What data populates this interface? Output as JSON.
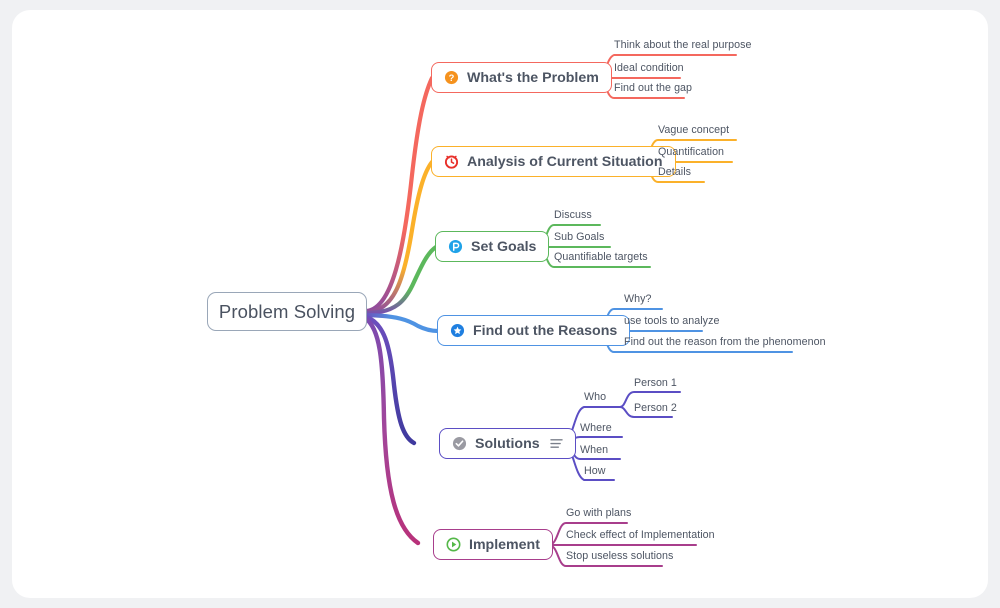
{
  "canvas": {
    "background": "#f0f1f3",
    "sheet_background": "#ffffff"
  },
  "root": {
    "label": "Problem Solving",
    "border_color": "#9aa7b8",
    "text_color": "#4a5260"
  },
  "branches": [
    {
      "id": "whats-the-problem",
      "label": "What's the Problem",
      "color": "#f4685e",
      "icon": "question-circle-icon",
      "icon_color": "#f5921e",
      "children": [
        {
          "label": "Think about the real purpose"
        },
        {
          "label": "Ideal condition"
        },
        {
          "label": "Find out the gap"
        }
      ]
    },
    {
      "id": "analysis-of-current-situation",
      "label": "Analysis of Current Situation",
      "color": "#fbb12a",
      "icon": "alarm-clock-icon",
      "icon_color": "#e8302a",
      "children": [
        {
          "label": "Vague concept"
        },
        {
          "label": "Quantification"
        },
        {
          "label": "Details"
        }
      ]
    },
    {
      "id": "set-goals",
      "label": "Set Goals",
      "color": "#5cb85c",
      "icon": "target-flag-circle-icon",
      "icon_color": "#1fa2e8",
      "children": [
        {
          "label": "Discuss"
        },
        {
          "label": "Sub Goals"
        },
        {
          "label": "Quantifiable targets"
        }
      ]
    },
    {
      "id": "find-out-the-reasons",
      "label": "Find out the Reasons",
      "color": "#4f93e3",
      "icon": "star-circle-icon",
      "icon_color": "#1f7fe0",
      "children": [
        {
          "label": "Why?"
        },
        {
          "label": "use tools to analyze"
        },
        {
          "label": "Find out the reason from the phenomenon"
        }
      ]
    },
    {
      "id": "solutions",
      "label": "Solutions",
      "color": "#5b4ec4",
      "icon": "check-circle-icon",
      "icon_color": "#9a9aa2",
      "notes_icon": "notes-lines-icon",
      "children": [
        {
          "label": "Who",
          "children": [
            {
              "label": "Person 1"
            },
            {
              "label": "Person 2"
            }
          ]
        },
        {
          "label": "Where"
        },
        {
          "label": "When"
        },
        {
          "label": "How"
        }
      ]
    },
    {
      "id": "implement",
      "label": "Implement",
      "color": "#a83e8c",
      "icon": "play-circle-icon",
      "icon_color": "#54b848",
      "children": [
        {
          "label": "Go with plans"
        },
        {
          "label": "Check effect of Implementation"
        },
        {
          "label": "Stop useless solutions"
        }
      ]
    }
  ]
}
